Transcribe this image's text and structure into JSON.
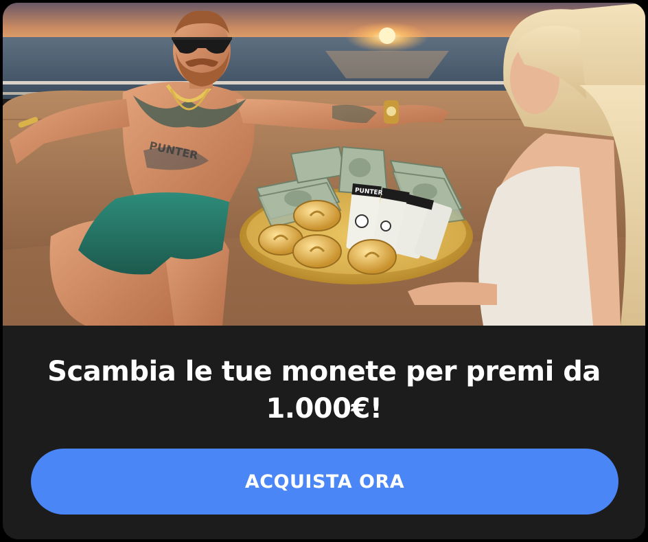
{
  "promo": {
    "title": "Scambia le tue monete per premi da 1.000€!",
    "cta_label": "ACQUISTA ORA"
  },
  "hero": {
    "image": "promo-illustration",
    "ticket_text": "PUNTER",
    "tattoo_text": "PUNTER"
  },
  "colors": {
    "card_background": "#1c1c1c",
    "button": "#4a86f5",
    "text": "#ffffff"
  }
}
